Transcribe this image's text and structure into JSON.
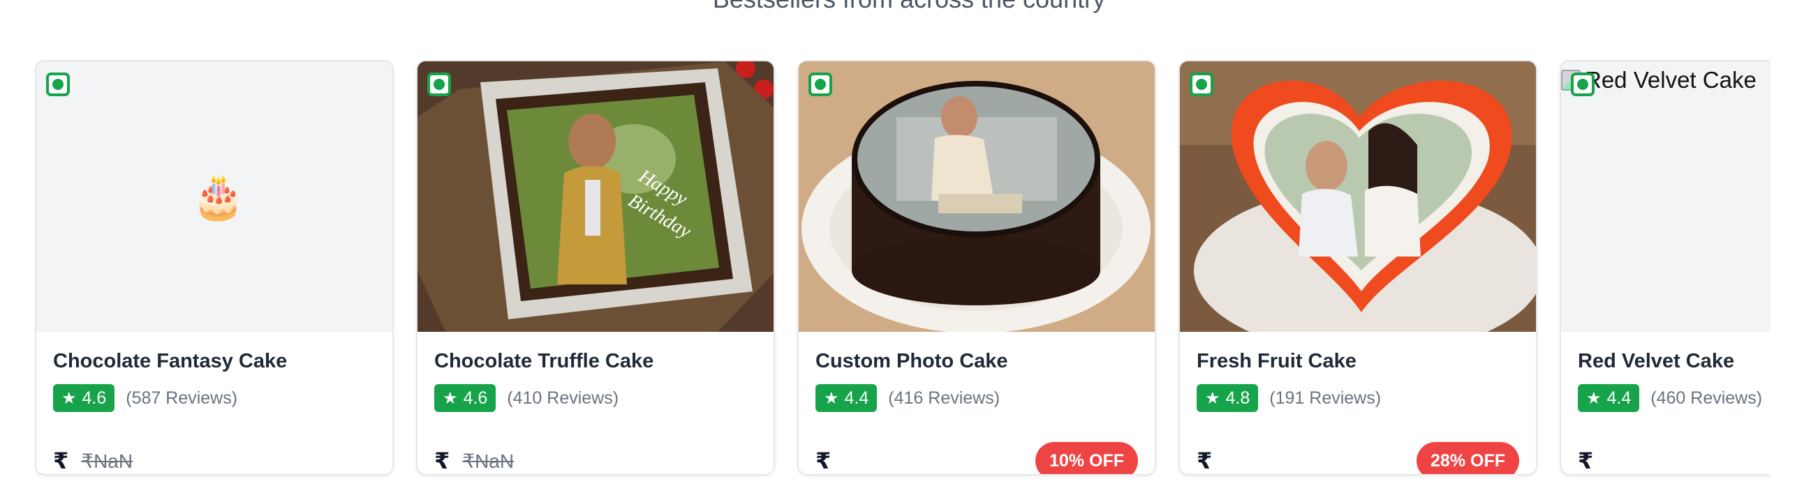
{
  "section": {
    "subtitle": "Bestsellers from across the country"
  },
  "colors": {
    "veg": "#16a34a",
    "rating": "#16a34a",
    "discount": "#ef4444"
  },
  "products": [
    {
      "title": "Chocolate Fantasy Cake",
      "rating": "4.6",
      "reviews": "(587 Reviews)",
      "currency": "₹",
      "mrp": "₹NaN",
      "discount": "",
      "image": "cake-emoji-placeholder",
      "placeholder_emoji": "🎂"
    },
    {
      "title": "Chocolate Truffle Cake",
      "rating": "4.6",
      "reviews": "(410 Reviews)",
      "currency": "₹",
      "mrp": "₹NaN",
      "discount": "",
      "image": "photo-cake-happy-birthday",
      "cake_text_1": "Happy",
      "cake_text_2": "Birthday"
    },
    {
      "title": "Custom Photo Cake",
      "rating": "4.4",
      "reviews": "(416 Reviews)",
      "currency": "₹",
      "mrp": "",
      "discount": "10% OFF",
      "image": "round-chocolate-photo-cake"
    },
    {
      "title": "Fresh Fruit Cake",
      "rating": "4.8",
      "reviews": "(191 Reviews)",
      "currency": "₹",
      "mrp": "",
      "discount": "28% OFF",
      "image": "heart-photo-cake"
    },
    {
      "title": "Red Velvet Cake",
      "rating": "4.4",
      "reviews": "(460 Reviews)",
      "currency": "₹",
      "mrp": "",
      "discount": "",
      "image": "broken-image",
      "alt": "Red Velvet Cake"
    }
  ]
}
